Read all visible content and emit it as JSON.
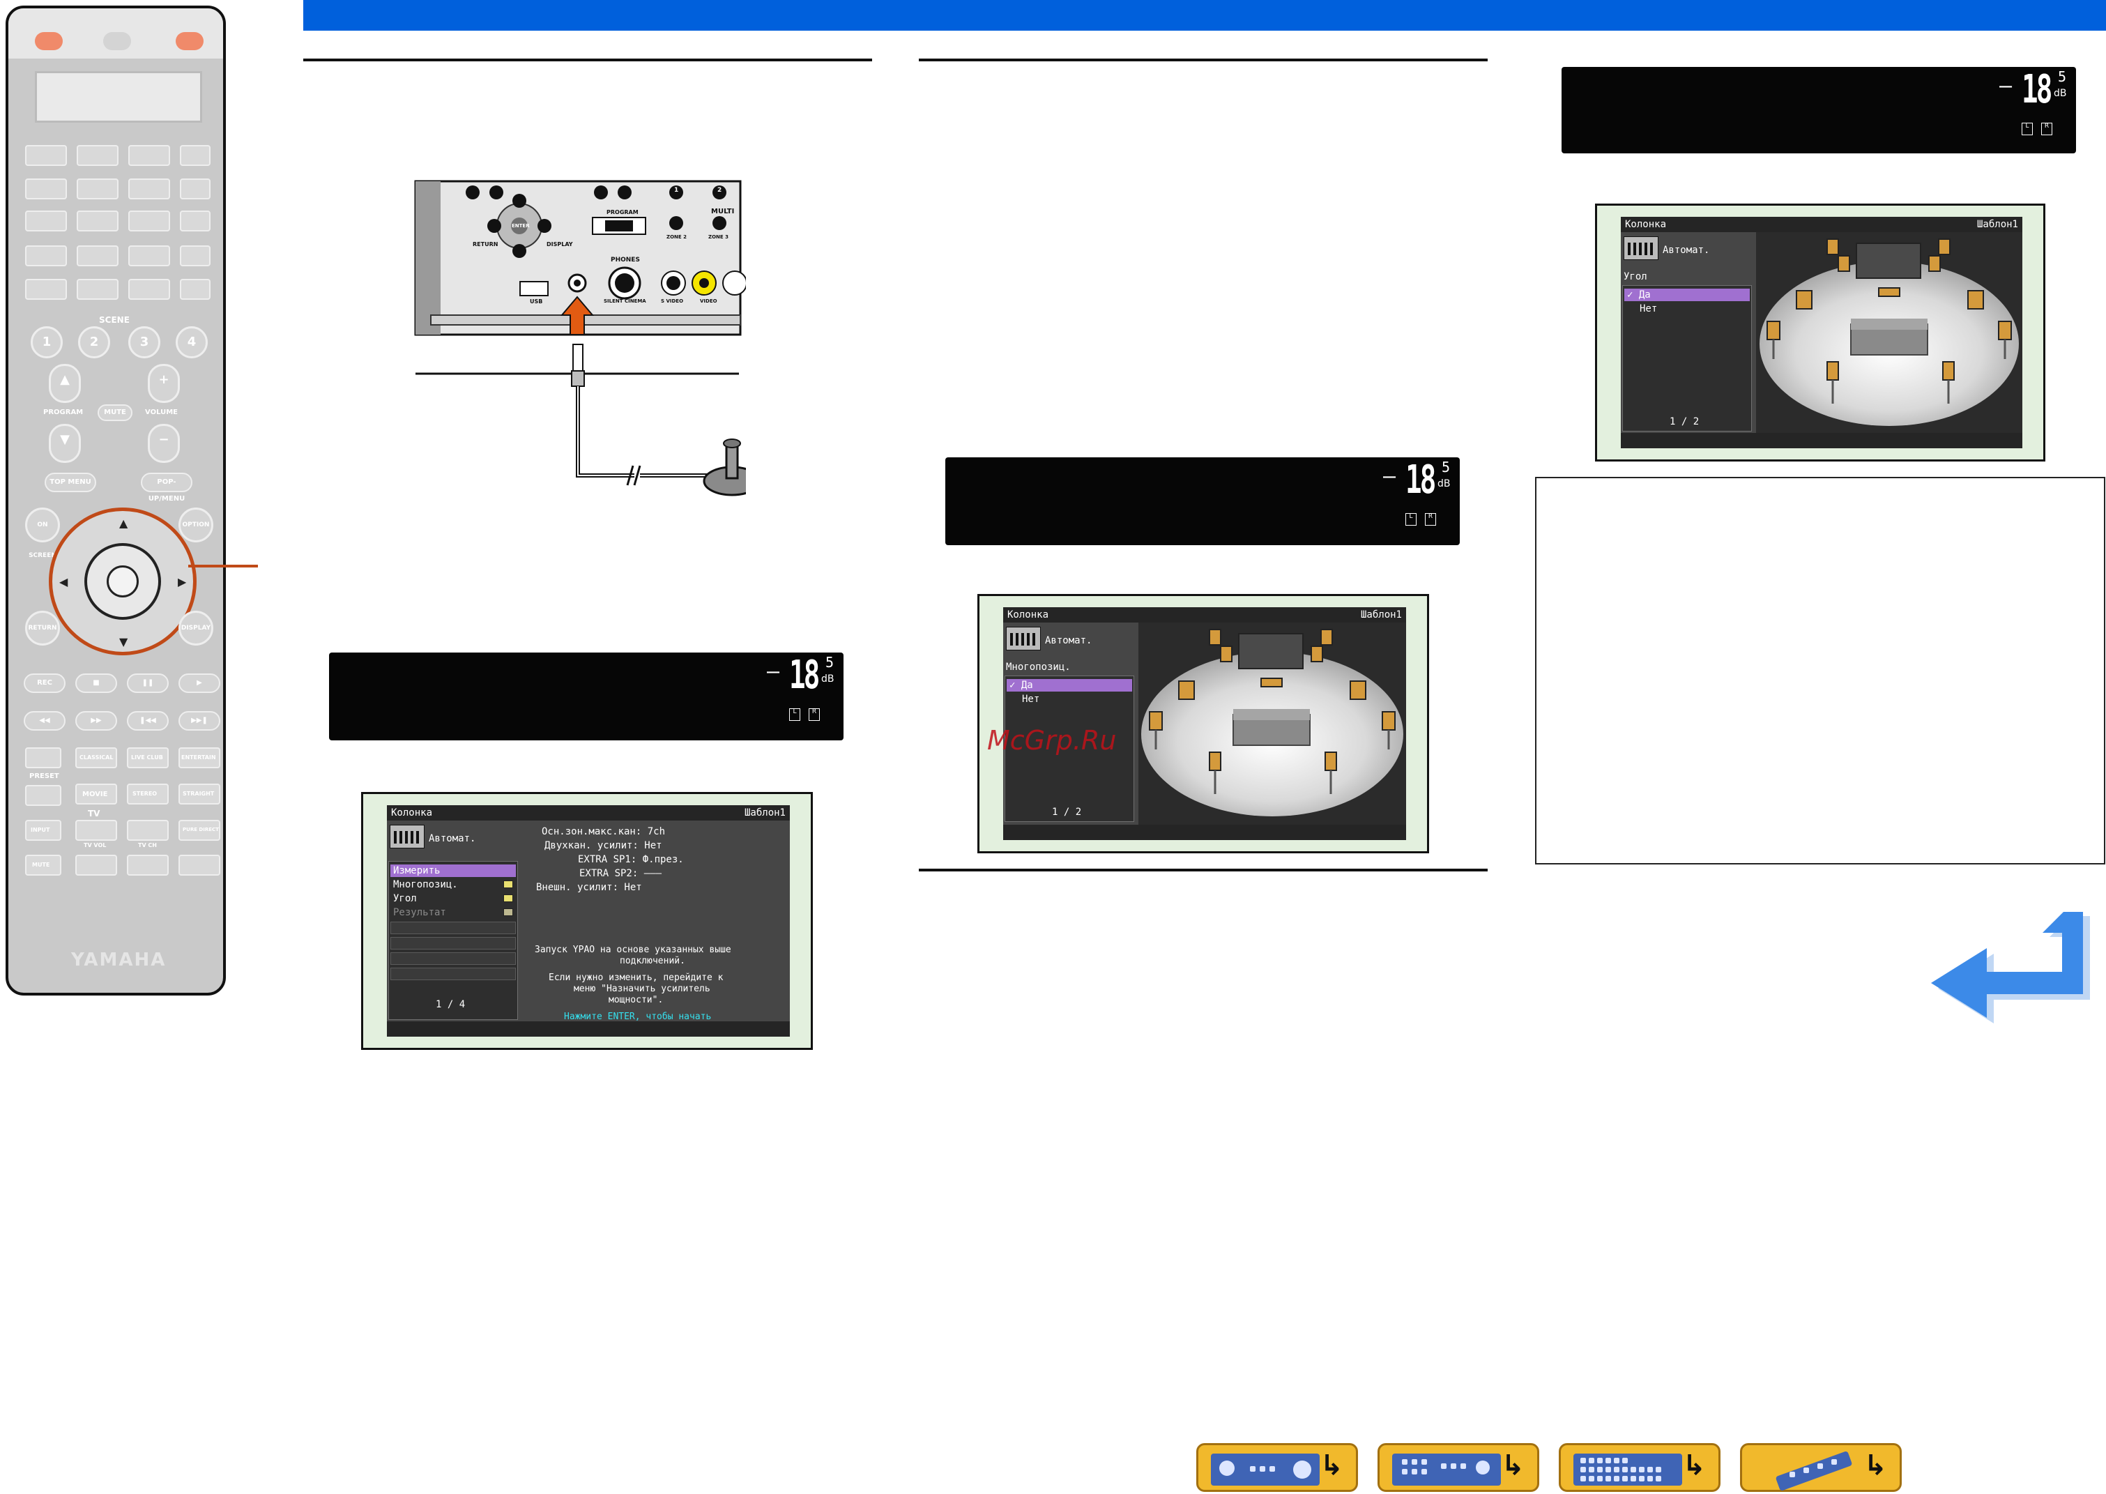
{
  "colors": {
    "top_bar": "#0060dc",
    "accent_orange": "#c04a18",
    "osd_select": "#a070d0",
    "nav_button": "#f1b92c",
    "watermark": "#c0121a"
  },
  "remote": {
    "brand": "YAMAHA",
    "scene_label": "SCENE",
    "scene_buttons": [
      "1",
      "2",
      "3",
      "4"
    ],
    "program_label": "PROGRAM",
    "volume_label": "VOLUME",
    "mute_small": "MUTE",
    "top_menu": "TOP MENU",
    "popup_menu": "POP-UP/MENU",
    "on_screen": "ON SCREEN",
    "option": "OPTION",
    "enter": "ENTER",
    "return": "RETURN",
    "display": "DISPLAY",
    "rec": "REC",
    "preset": "PRESET",
    "classical": "CLASSICAL",
    "live_club": "LIVE CLUB",
    "entertain": "ENTERTAIN",
    "movie": "MOVIE",
    "stereo": "STEREO",
    "straight": "STRAIGHT",
    "tv": "TV",
    "input": "INPUT",
    "tv_vol": "TV VOL",
    "tv_ch": "TV CH",
    "pure_direct": "PURE DIRECT",
    "mute": "MUTE",
    "plus": "+",
    "minus": "−"
  },
  "front_panel": {
    "buttons": {
      "return": "RETURN",
      "enter": "ENTER",
      "display": "DISPLAY",
      "program": "PROGRAM",
      "multi": "MULTI",
      "zone2": "ZONE 2",
      "zone3": "ZONE 3"
    },
    "jacks": {
      "usb": "USB",
      "phones": "PHONES",
      "silent_cinema": "SILENT CINEMA",
      "s_video": "S VIDEO",
      "video": "VIDEO"
    },
    "button_numbers": [
      "1",
      "2"
    ]
  },
  "display_readout": {
    "minus": "–",
    "value": "18",
    "decimal": "5",
    "unit": "dB",
    "indicator_l": "L",
    "indicator_r": "R",
    "indicator_sub": "SW1 SW2"
  },
  "osd_measure": {
    "header_left": "Колонка",
    "header_right": "Шаблон1",
    "auto_label": "Автомат.",
    "menu_items": [
      "Измерить",
      "Многопозиц.",
      "Угол",
      "Результат"
    ],
    "page": "1 / 4",
    "info_lines": [
      "Осн.зон.макс.кан: 7ch",
      "Двухкан. усилит: Нет",
      "EXTRA SP1: Ф.през.",
      "EXTRA SP2: –––",
      "Внешн. усилит: Нет"
    ],
    "message_lines": [
      "Запуск YPAO на основе указанных выше",
      "подключений.",
      "Если нужно изменить, перейдите к",
      "меню \"Назначить усилитель",
      "мощности\"."
    ],
    "prompt": "Нажмите ENTER, чтобы начать"
  },
  "osd_multipos": {
    "header_left": "Колонка",
    "header_right": "Шаблон1",
    "auto_label": "Автомат.",
    "section_label": "Многопозиц.",
    "options": [
      "Да",
      "Нет"
    ],
    "check": "✓",
    "page": "1 / 2"
  },
  "osd_angle": {
    "header_left": "Колонка",
    "header_right": "Шаблон1",
    "auto_label": "Автомат.",
    "section_label": "Угол",
    "options": [
      "Да",
      "Нет"
    ],
    "check": "✓",
    "page": "1 / 2"
  },
  "watermark": "McGrp.Ru",
  "bottom_nav": [
    {
      "icon": "receiver-front-icon",
      "arrow": "↳"
    },
    {
      "icon": "receiver-rear-icon",
      "arrow": "↳"
    },
    {
      "icon": "keyboard-grid-icon",
      "arrow": "↳"
    },
    {
      "icon": "remote-control-icon",
      "arrow": "↳"
    }
  ]
}
